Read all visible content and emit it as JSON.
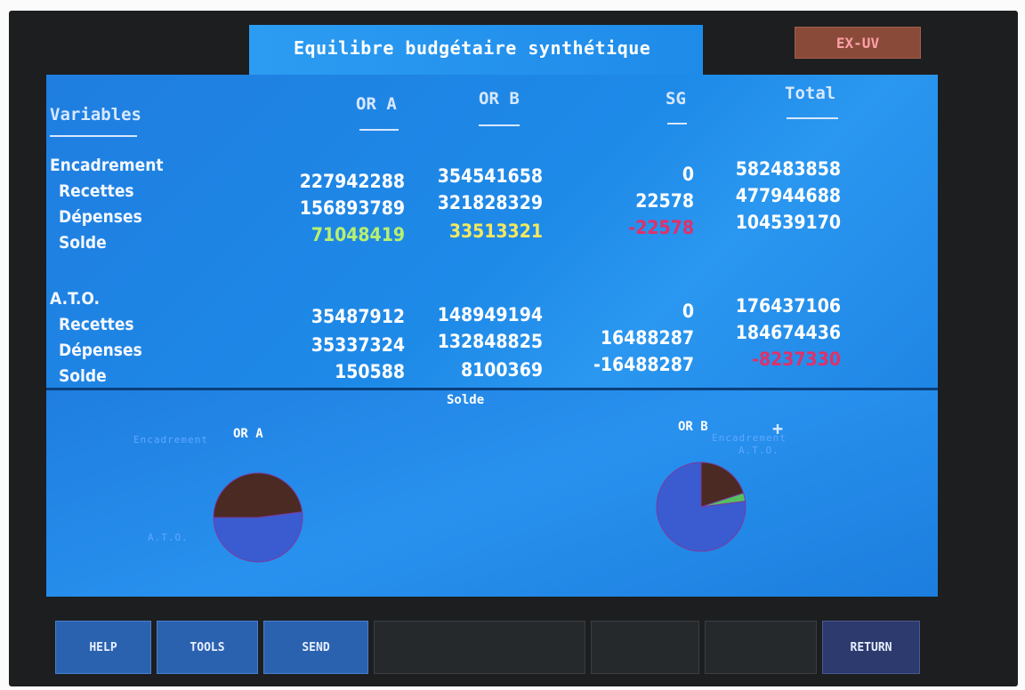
{
  "title": "Equilibre budgétaire synthétique",
  "corner_button": "EX-UV",
  "columns": {
    "variables": "Variables",
    "or_a": "OR A",
    "or_b": "OR B",
    "sg": "SG",
    "total": "Total"
  },
  "encadrement": {
    "label": "Encadrement",
    "rows": [
      {
        "label": "",
        "or_a": "",
        "or_b": "",
        "sg": "",
        "total": ""
      },
      {
        "label": "Recettes",
        "or_a": "227942288",
        "or_b": "354541658",
        "sg": "0",
        "total": "582483858"
      },
      {
        "label": "Dépenses",
        "or_a": "156893789",
        "or_b": "321828329",
        "sg": "22578",
        "total": "477944688"
      },
      {
        "label": "Solde",
        "or_a": "71048419",
        "or_b": "33513321",
        "sg": "-22578",
        "total": "104539170"
      }
    ]
  },
  "ato": {
    "label": "A.T.O.",
    "rows": [
      {
        "label": "Recettes",
        "or_a": "35487912",
        "or_b": "148949194",
        "sg": "0",
        "total": "176437106"
      },
      {
        "label": "Dépenses",
        "or_a": "35337324",
        "or_b": "132848825",
        "sg": "16488287",
        "total": "184674436"
      },
      {
        "label": "Solde",
        "or_a": "150588",
        "or_b": "8100369",
        "sg": "-16488287",
        "total": "-8237330"
      }
    ]
  },
  "colors": {
    "solde_or_a": "#b8f070",
    "solde_or_b": "#f4e860",
    "negative": "#e0306a"
  },
  "chart_section_label": "Solde",
  "chart_data": [
    {
      "type": "pie",
      "title": "OR A",
      "slices": [
        {
          "label": "Encadrement",
          "value": 0.48,
          "color": "#4a2a22"
        },
        {
          "label": "A.T.O.",
          "value": 0.52,
          "color": "#3a5cd0"
        }
      ]
    },
    {
      "type": "pie",
      "title": "OR B",
      "slices": [
        {
          "label": "Encadrement",
          "value": 0.2,
          "color": "#4a2a22"
        },
        {
          "label": "A.T.O.",
          "value": 0.03,
          "color": "#55c060"
        },
        {
          "label": "",
          "value": 0.77,
          "color": "#3a5cd0"
        }
      ]
    }
  ],
  "function_keys": [
    "HELP",
    "TOOLS",
    "SEND",
    "",
    "",
    "",
    "",
    "RETURN"
  ]
}
